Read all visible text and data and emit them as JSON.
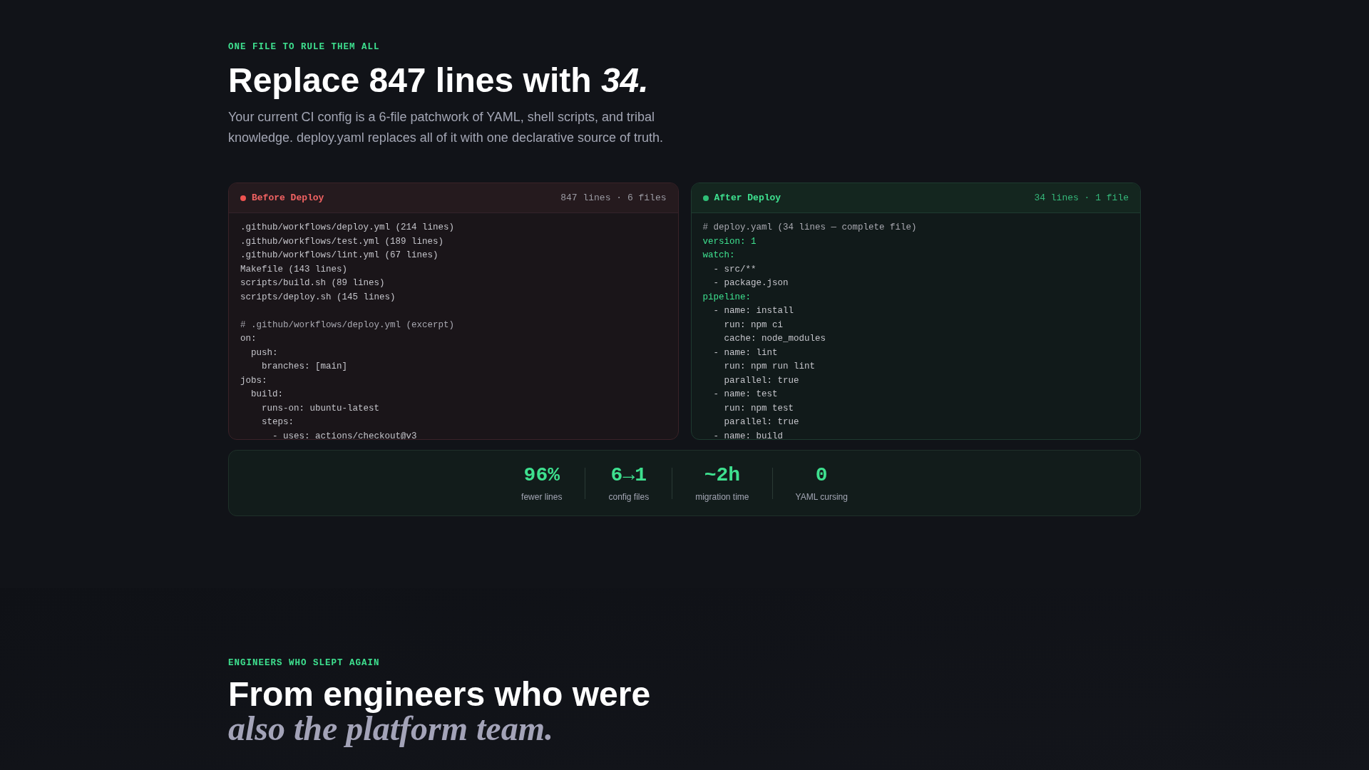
{
  "intro": {
    "eyebrow": "ONE FILE TO RULE THEM ALL",
    "heading": "Replace 847 lines with *34.*",
    "description": "Your current CI config is a 6-file patchwork of YAML, shell scripts, and tribal knowledge. deploy.yaml replaces all of it with one declarative source of truth."
  },
  "panels": [
    {
      "kind": "before",
      "title": "Before Deploy",
      "meta": "847 lines · 6 files",
      "lines": [
        {
          "kind": "plain",
          "text": ".github/workflows/deploy.yml (214 lines)"
        },
        {
          "kind": "plain",
          "text": ".github/workflows/test.yml (189 lines)"
        },
        {
          "kind": "plain",
          "text": ".github/workflows/lint.yml (67 lines)"
        },
        {
          "kind": "plain",
          "text": "Makefile (143 lines)"
        },
        {
          "kind": "plain",
          "text": "scripts/build.sh (89 lines)"
        },
        {
          "kind": "plain",
          "text": "scripts/deploy.sh (145 lines)"
        },
        {
          "kind": "blank"
        },
        {
          "kind": "comment",
          "text": "# .github/workflows/deploy.yml (excerpt)"
        },
        {
          "kind": "plain",
          "text": "on:"
        },
        {
          "kind": "plain",
          "text": "  push:"
        },
        {
          "kind": "plain",
          "text": "    branches: [main]"
        },
        {
          "kind": "plain",
          "text": "jobs:"
        },
        {
          "kind": "plain",
          "text": "  build:"
        },
        {
          "kind": "plain",
          "text": "    runs-on: ubuntu-latest"
        },
        {
          "kind": "plain",
          "text": "    steps:"
        },
        {
          "kind": "plain",
          "text": "      - uses: actions/checkout@v3"
        }
      ]
    },
    {
      "kind": "after",
      "title": "After Deploy",
      "meta": "34 lines · 1 file",
      "lines": [
        {
          "kind": "comment",
          "text": "# deploy.yaml (34 lines — complete file)"
        },
        {
          "kind": "key",
          "text": "version: 1"
        },
        {
          "kind": "key",
          "text": "watch:"
        },
        {
          "kind": "plain",
          "text": "  - src/**"
        },
        {
          "kind": "plain",
          "text": "  - package.json"
        },
        {
          "kind": "key",
          "text": "pipeline:"
        },
        {
          "kind": "plain",
          "text": "  - name: install"
        },
        {
          "kind": "plain",
          "text": "    run: npm ci"
        },
        {
          "kind": "plain",
          "text": "    cache: node_modules"
        },
        {
          "kind": "plain",
          "text": "  - name: lint"
        },
        {
          "kind": "plain",
          "text": "    run: npm run lint"
        },
        {
          "kind": "plain",
          "text": "    parallel: true"
        },
        {
          "kind": "plain",
          "text": "  - name: test"
        },
        {
          "kind": "plain",
          "text": "    run: npm test"
        },
        {
          "kind": "plain",
          "text": "    parallel: true"
        },
        {
          "kind": "plain",
          "text": "  - name: build"
        }
      ]
    }
  ],
  "stats": [
    {
      "value": "96%",
      "label": "fewer lines"
    },
    {
      "value": "6→1",
      "label": "config files"
    },
    {
      "value": "~2h",
      "label": "migration time"
    },
    {
      "value": "0",
      "label": "YAML cursing"
    }
  ],
  "testimonials": {
    "eyebrow": "ENGINEERS WHO SLEPT AGAIN",
    "heading_lines": [
      {
        "kind": "plain",
        "text": "From engineers who were"
      },
      {
        "kind": "accent",
        "text": "also the platform team."
      }
    ]
  }
}
